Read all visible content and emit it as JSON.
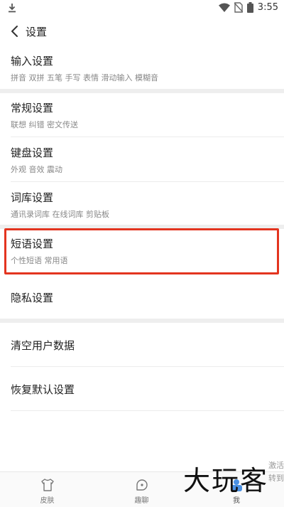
{
  "status": {
    "time": "3:55"
  },
  "header": {
    "title": "设置"
  },
  "items": [
    {
      "label": "输入设置",
      "sub": "拼音 双拼 五笔 手写 表情 滑动输入 模糊音"
    },
    {
      "label": "常规设置",
      "sub": "联想 纠错 密文传送"
    },
    {
      "label": "键盘设置",
      "sub": "外观 音效 震动"
    },
    {
      "label": "词库设置",
      "sub": "通讯录词库 在线词库 剪贴板"
    },
    {
      "label": "短语设置",
      "sub": "个性短语 常用语"
    },
    {
      "label": "隐私设置"
    },
    {
      "label": "清空用户数据"
    },
    {
      "label": "恢复默认设置"
    }
  ],
  "nav": [
    {
      "label": "皮肤",
      "icon": "shirt-icon"
    },
    {
      "label": "趣聊",
      "icon": "chat-icon"
    },
    {
      "label": "我",
      "icon": "profile-icon",
      "active": true
    }
  ],
  "watermark": {
    "text": "大玩客",
    "side_top": "激活",
    "side_bottom": "转到"
  },
  "colors": {
    "highlight": "#e3341f",
    "separator": "#eeeeee"
  }
}
